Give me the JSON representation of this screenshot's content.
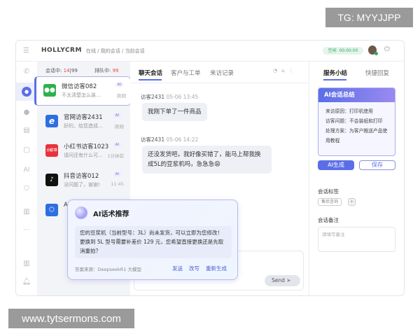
{
  "watermark_top": "TG: MYYJJPP",
  "watermark_bottom": "www.tytsermons.com",
  "header": {
    "brand": "HOLLYCRM",
    "breadcrumb": "在线 / 我的会话 / 当前会话",
    "status": "空闲",
    "timer": "00:00:00"
  },
  "list": {
    "active_label": "会话中:",
    "active_count": "14",
    "active_total": "99",
    "queue_label": "排队中:",
    "queue_count": "99",
    "items": [
      {
        "name": "微信访客082",
        "preview": "不太清楚怎么装…",
        "time": "刚刚",
        "badge": "AI",
        "logo": "wechat-icon",
        "color": "#2bb24c"
      },
      {
        "name": "官网访客2431",
        "preview": "好的，给您造成…",
        "time": "刚刚",
        "badge": "AI",
        "logo": "browser-e-icon",
        "color": "#2d6fe0"
      },
      {
        "name": "小红书访客1023",
        "preview": "请问还有什么可…",
        "time": "1分钟前",
        "badge": "AI",
        "logo": "xiaohongshu-icon",
        "color": "#e8333a",
        "logo_text": "小红书"
      },
      {
        "name": "抖音访客012",
        "preview": "没问题了，谢谢!",
        "time": "11:45",
        "badge": "AI",
        "logo": "douyin-icon",
        "color": "#111111"
      },
      {
        "name": "A",
        "preview": "",
        "time": "",
        "badge": "",
        "logo": "cube-icon",
        "color": "#2d6fe0"
      }
    ]
  },
  "chat": {
    "tabs": [
      "聊天会话",
      "客户与工单",
      "来访记录"
    ],
    "messages": [
      {
        "sender": "访客2431",
        "time": "05-06 13:45",
        "text": "我刚下单了一件商品"
      },
      {
        "sender": "访客2431",
        "time": "05-06 14:22",
        "text": "还没发货吧，我好像买错了，能马上帮我换成5L的豆浆机吗，急急急😩"
      }
    ],
    "send_label": "Send"
  },
  "ai_popup": {
    "title": "AI话术推荐",
    "text": "您的豆浆机（当前型号：3L）尚未发货，可以立即为您修改！更换到 5L 型号需要补差价 129 元，您希望直接更换还是先取消重拍？",
    "source": "答案来源：DeepseekR1 大模型",
    "actions": [
      "发送",
      "改写",
      "重新生成"
    ]
  },
  "right": {
    "tabs": [
      "服务小结",
      "快捷回复"
    ],
    "summary_title": "AI会话总结",
    "summary_lines": [
      "来访原因：打印机使用",
      "访客问题：不会装纸和打印",
      "处理方案：为客户推送产品使用教程"
    ],
    "generate_label": "AI生成",
    "save_label": "保存",
    "tags_title": "会话标签",
    "tag": "售后咨询",
    "tag_add": "+",
    "notes_title": "会话备注",
    "notes_placeholder": "请填写备注"
  },
  "colors": {
    "accent": "#5b6ee8",
    "danger": "#e5484d",
    "status_green": "#3aa66a"
  }
}
